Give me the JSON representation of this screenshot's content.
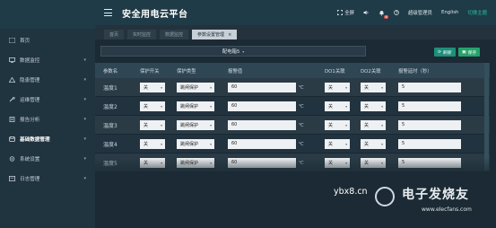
{
  "app": {
    "title": "安全用电云平台"
  },
  "header": {
    "fullscreen_label": "全屏",
    "notification_count": "6",
    "user": "超级管理员",
    "language": "English",
    "switch_theme": "切换主题"
  },
  "sidebar": {
    "items": [
      {
        "label": "首页",
        "icon": "home-icon"
      },
      {
        "label": "数据监控",
        "icon": "monitor-icon"
      },
      {
        "label": "隐患管理",
        "icon": "warning-icon"
      },
      {
        "label": "运维管理",
        "icon": "wrench-icon"
      },
      {
        "label": "报告分析",
        "icon": "report-icon"
      },
      {
        "label": "基础数据管理",
        "icon": "database-icon"
      },
      {
        "label": "系统设置",
        "icon": "gear-icon"
      },
      {
        "label": "日志管理",
        "icon": "log-icon"
      }
    ]
  },
  "tabs": [
    {
      "label": "首页"
    },
    {
      "label": "实时监控"
    },
    {
      "label": "数据监控"
    },
    {
      "label": "参数设置管理",
      "active": true
    }
  ],
  "toolbar": {
    "device_select": "配电箱5",
    "refresh_label": "刷新",
    "save_label": "保存"
  },
  "table": {
    "headers": [
      "参数名",
      "保护开关",
      "保护类型",
      "报警值",
      "DO1关联",
      "DO2关联",
      "报警延时（秒）"
    ],
    "unit": "℃",
    "rows": [
      {
        "name": "温度1",
        "switch": "关",
        "type": "跳闸保护",
        "value": "60",
        "do1": "关",
        "do2": "关",
        "delay": "5"
      },
      {
        "name": "温度2",
        "switch": "关",
        "type": "跳闸保护",
        "value": "60",
        "do1": "关",
        "do2": "关",
        "delay": "5"
      },
      {
        "name": "温度3",
        "switch": "关",
        "type": "跳闸保护",
        "value": "60",
        "do1": "关",
        "do2": "关",
        "delay": "5"
      },
      {
        "name": "温度4",
        "switch": "关",
        "type": "跳闸保护",
        "value": "60",
        "do1": "关",
        "do2": "关",
        "delay": "5"
      },
      {
        "name": "温度5",
        "switch": "关",
        "type": "跳闸保护",
        "value": "60",
        "do1": "关",
        "do2": "关",
        "delay": "5"
      }
    ]
  },
  "watermark": {
    "text": "ybx8.cn",
    "cn": "电子发烧友",
    "url": "www.elecfans.com"
  }
}
